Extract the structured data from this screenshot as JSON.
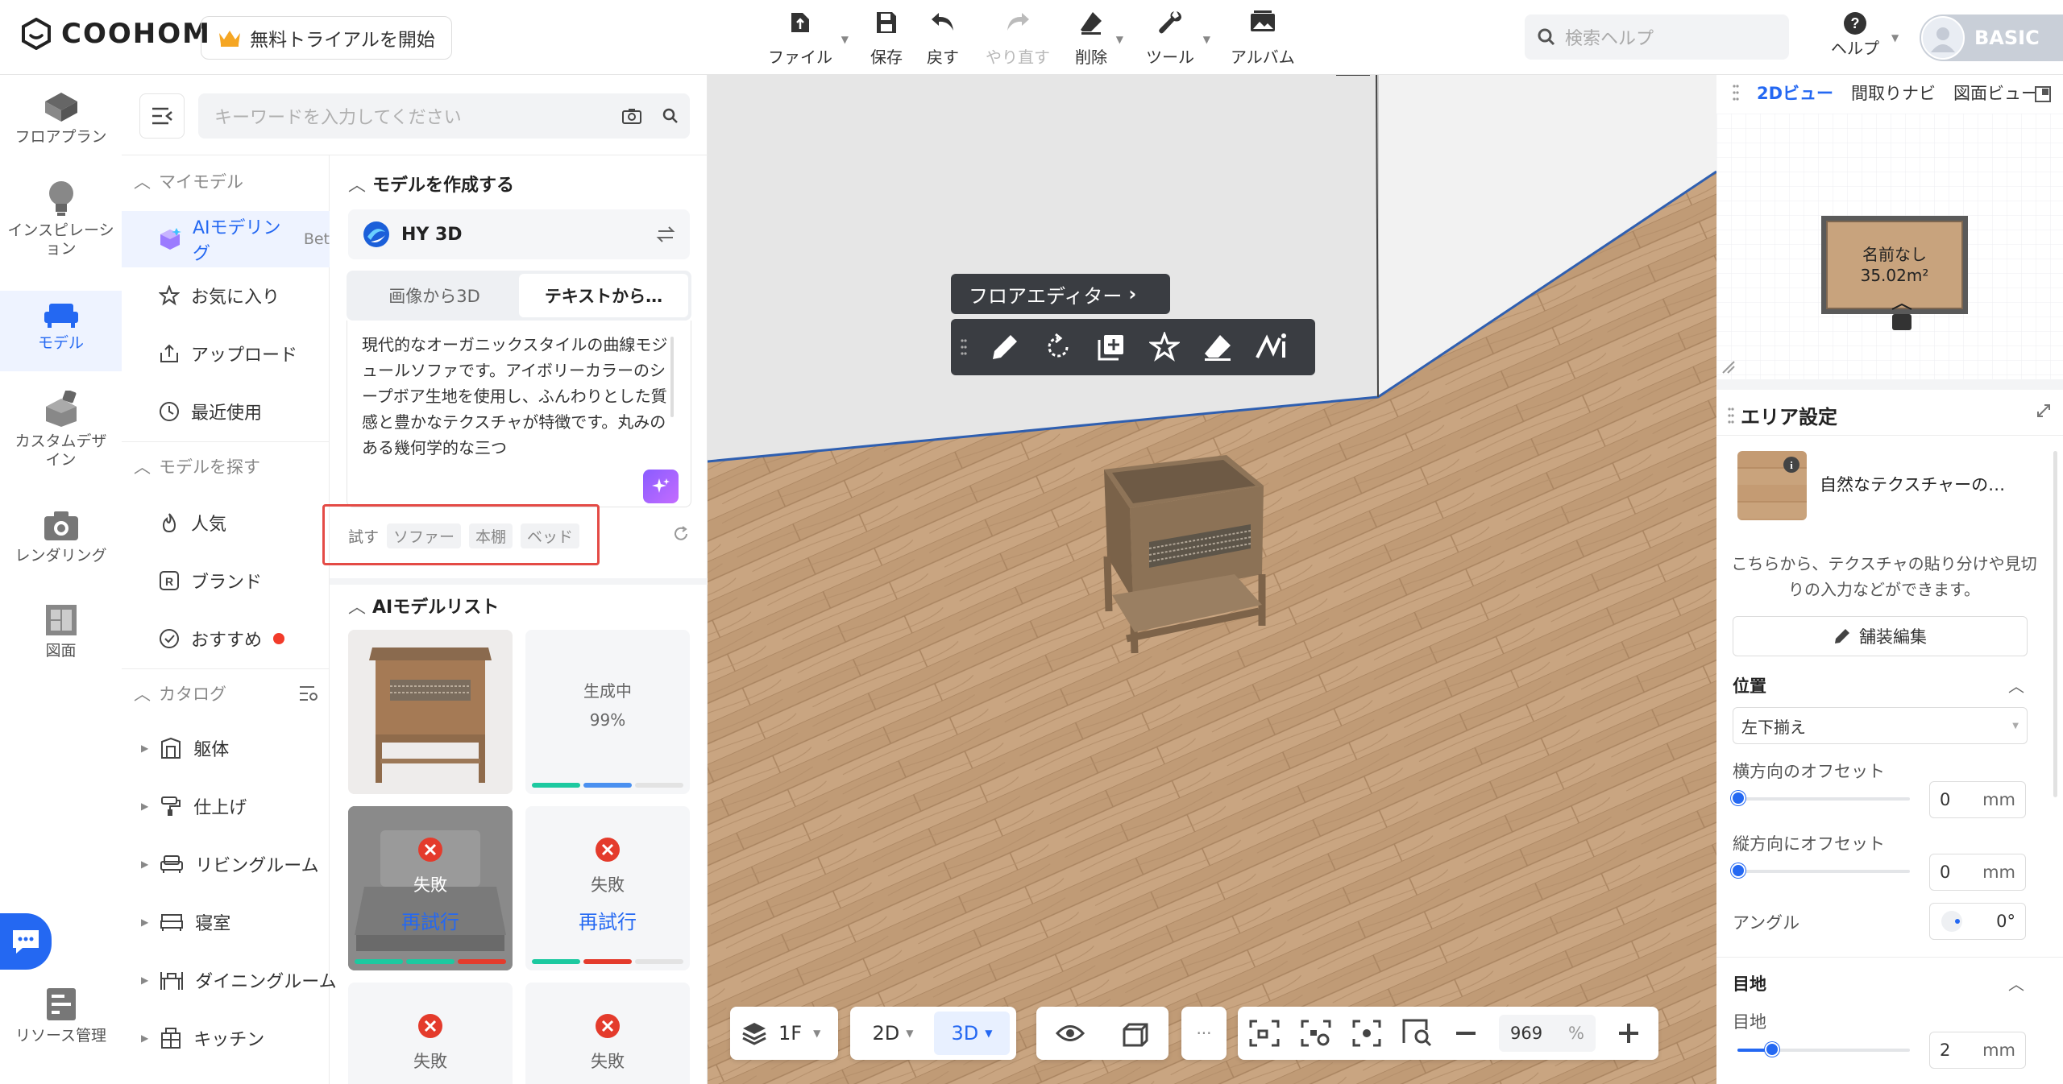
{
  "app": {
    "logo": "COOHOM",
    "trial_button": "無料トライアルを開始"
  },
  "toolbar": {
    "file": "ファイル",
    "save": "保存",
    "undo": "戻す",
    "redo": "やり直す",
    "delete": "削除",
    "tools": "ツール",
    "album": "アルバム"
  },
  "search_help": {
    "placeholder": "検索ヘルプ"
  },
  "help": {
    "label": "ヘルプ"
  },
  "plan": {
    "label": "BASIC"
  },
  "rail": [
    {
      "label": "フロアプラン",
      "icon": "floorplan-icon"
    },
    {
      "label": "インスピレーション",
      "icon": "bulb-icon"
    },
    {
      "label": "モデル",
      "icon": "sofa-icon"
    },
    {
      "label": "カスタムデザイン",
      "icon": "custom-design-icon"
    },
    {
      "label": "レンダリング",
      "icon": "camera-icon"
    },
    {
      "label": "図面",
      "icon": "drawing-icon"
    },
    {
      "label": "リソース管理",
      "icon": "resource-icon"
    }
  ],
  "panel": {
    "search_placeholder": "キーワードを入力してください",
    "my_models": "マイモデル",
    "ai_modeling": "AIモデリング",
    "ai_modeling_badge": "Bet",
    "favorites": "お気に入り",
    "upload": "アップロード",
    "recent": "最近使用",
    "find_models": "モデルを探す",
    "popular": "人気",
    "brand": "ブランド",
    "recommended": "おすすめ",
    "catalog": "カタログ",
    "catalog_items": [
      "躯体",
      "仕上げ",
      "リビングルーム",
      "寝室",
      "ダイニングルーム",
      "キッチン"
    ]
  },
  "create": {
    "title": "モデルを作成する",
    "engine": "HY 3D",
    "tab_image": "画像から3D",
    "tab_text": "テキストから…",
    "prompt": "現代的なオーガニックスタイルの曲線モジュールソファです。アイボリーカラーのシープボア生地を使用し、ふんわりとした質感と豊かなテクスチャが特徴です。丸みのある幾何学的な三つ",
    "try_label": "試す",
    "chips": [
      "ソファー",
      "本棚",
      "ベッド"
    ]
  },
  "ai_list": {
    "title": "AIモデルリスト",
    "generating": "生成中",
    "progress": "99%",
    "failed": "失敗",
    "retry": "再試行"
  },
  "floor_editor": {
    "title": "フロアエディター"
  },
  "bottom": {
    "floor": "1F",
    "view_2d": "2D",
    "view_3d": "3D",
    "more": "···",
    "zoom": "969",
    "zoom_unit": "%"
  },
  "minimap": {
    "tab_2d": "2Dビュー",
    "tab_nav": "間取りナビ",
    "tab_drawing": "図面ビュー",
    "room_name": "名前なし",
    "room_area": "35.02m²"
  },
  "area_settings": {
    "title": "エリア設定",
    "texture_name": "自然なテクスチャーの…",
    "hint": "こちらから、テクスチャの貼り分けや見切りの入力などができます。",
    "edit_button": "舗装編集",
    "position": "位置",
    "align": "左下揃え",
    "h_offset": "横方向のオフセット",
    "h_value": "0",
    "v_offset": "縦方向にオフセット",
    "v_value": "0",
    "unit_mm": "mm",
    "angle": "アングル",
    "angle_value": "0°",
    "joint_section": "目地",
    "joint_label": "目地",
    "joint_value": "2"
  },
  "colors": {
    "accent": "#2468f2",
    "danger": "#e44b46",
    "dark_toolbar": "#3a3d42"
  }
}
